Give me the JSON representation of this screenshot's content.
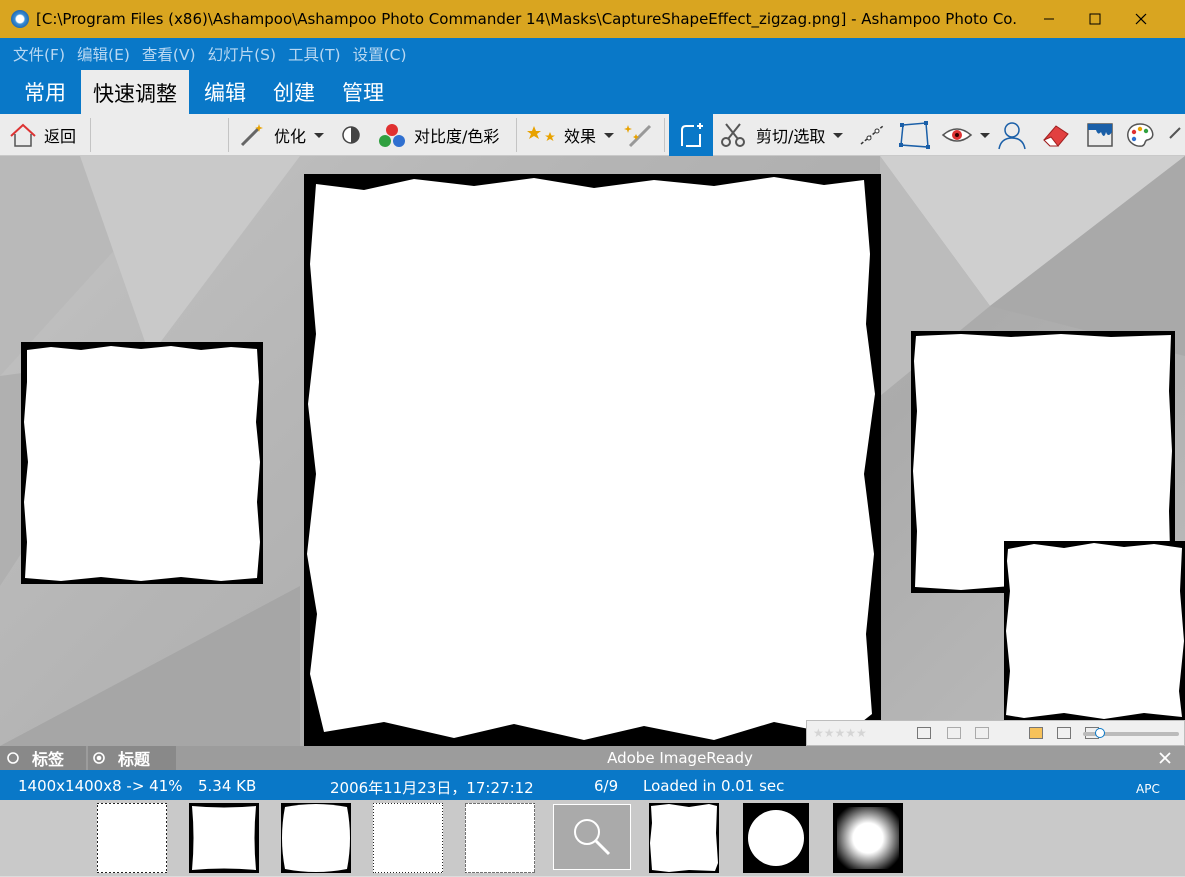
{
  "window": {
    "title": "[C:\\Program Files (x86)\\Ashampoo\\Ashampoo Photo Commander 14\\Masks\\CaptureShapeEffect_zigzag.png] - Ashampoo Photo Co..."
  },
  "menu": {
    "items": [
      "文件(F)",
      "编辑(E)",
      "查看(V)",
      "幻灯片(S)",
      "工具(T)",
      "设置(C)"
    ]
  },
  "ribbon": {
    "tabs": [
      "常用",
      "快速调整",
      "编辑",
      "创建",
      "管理"
    ],
    "active_tab": "快速调整"
  },
  "toolbar": {
    "back_label": "返回",
    "optimize_label": "优化",
    "contrast_label": "对比度/色彩",
    "effects_label": "效果",
    "cut_label": "剪切/选取"
  },
  "panel": {
    "tab_tags": "标签",
    "tab_title": "标题",
    "source_label": "Adobe ImageReady"
  },
  "status": {
    "dimensions": "1400x1400x8 -> 41%",
    "filesize": "5.34 KB",
    "date": "2006年11月23日，17:27:12",
    "position": "6/9",
    "load_time": "Loaded in 0.01 sec",
    "apc": "APC"
  },
  "colors": {
    "titlebar": "#d9a520",
    "ribbon": "#0978c8",
    "toolbar": "#ececec"
  }
}
